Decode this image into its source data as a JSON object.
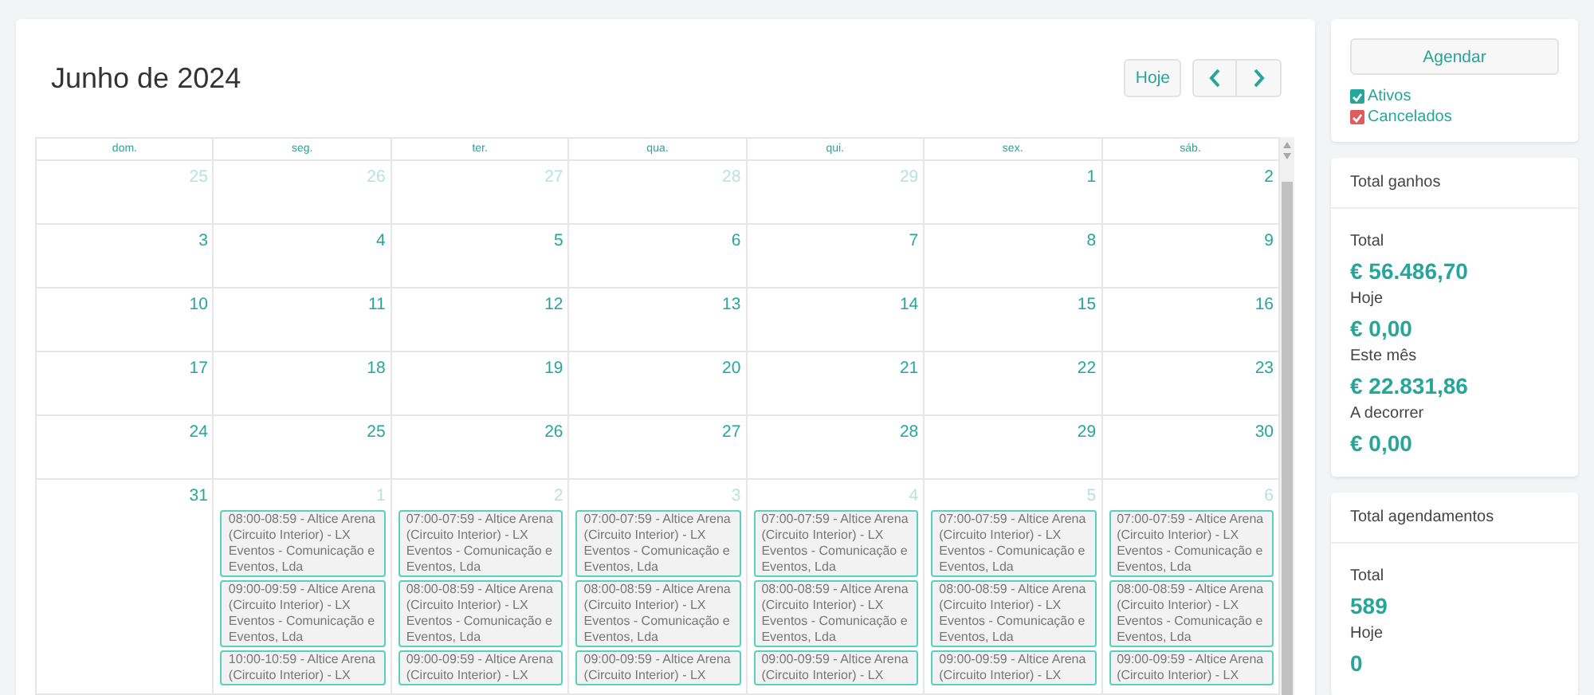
{
  "calendar": {
    "title": "Junho de 2024",
    "today_button": "Hoje",
    "weekdays": [
      "dom.",
      "seg.",
      "ter.",
      "qua.",
      "qui.",
      "sex.",
      "sáb."
    ],
    "weeks": [
      [
        {
          "day": "25",
          "other_month": true
        },
        {
          "day": "26",
          "other_month": true
        },
        {
          "day": "27",
          "other_month": true
        },
        {
          "day": "28",
          "other_month": true
        },
        {
          "day": "29",
          "other_month": true
        },
        {
          "day": "1",
          "other_month": false
        },
        {
          "day": "2",
          "other_month": false
        }
      ],
      [
        {
          "day": "3",
          "other_month": false
        },
        {
          "day": "4",
          "other_month": false
        },
        {
          "day": "5",
          "other_month": false
        },
        {
          "day": "6",
          "other_month": false
        },
        {
          "day": "7",
          "other_month": false
        },
        {
          "day": "8",
          "other_month": false
        },
        {
          "day": "9",
          "other_month": false
        }
      ],
      [
        {
          "day": "10",
          "other_month": false
        },
        {
          "day": "11",
          "other_month": false
        },
        {
          "day": "12",
          "other_month": false
        },
        {
          "day": "13",
          "other_month": false
        },
        {
          "day": "14",
          "other_month": false
        },
        {
          "day": "15",
          "other_month": false
        },
        {
          "day": "16",
          "other_month": false
        }
      ],
      [
        {
          "day": "17",
          "other_month": false
        },
        {
          "day": "18",
          "other_month": false
        },
        {
          "day": "19",
          "other_month": false
        },
        {
          "day": "20",
          "other_month": false
        },
        {
          "day": "21",
          "other_month": false
        },
        {
          "day": "22",
          "other_month": false
        },
        {
          "day": "23",
          "other_month": false
        }
      ],
      [
        {
          "day": "24",
          "other_month": false
        },
        {
          "day": "25",
          "other_month": false
        },
        {
          "day": "26",
          "other_month": false
        },
        {
          "day": "27",
          "other_month": false
        },
        {
          "day": "28",
          "other_month": false
        },
        {
          "day": "29",
          "other_month": false
        },
        {
          "day": "30",
          "other_month": false
        }
      ],
      [
        {
          "day": "31",
          "other_month": false
        },
        {
          "day": "1",
          "other_month": true,
          "events": [
            "08:00-08:59 - Altice Arena (Circuito Interior) - LX Eventos - Comunicação e Eventos, Lda",
            "09:00-09:59 - Altice Arena (Circuito Interior) - LX Eventos - Comunicação e Eventos, Lda",
            "10:00-10:59 - Altice Arena (Circuito Interior) - LX"
          ]
        },
        {
          "day": "2",
          "other_month": true,
          "events": [
            "07:00-07:59 - Altice Arena (Circuito Interior) - LX Eventos - Comunicação e Eventos, Lda",
            "08:00-08:59 - Altice Arena (Circuito Interior) - LX Eventos - Comunicação e Eventos, Lda",
            "09:00-09:59 - Altice Arena (Circuito Interior) - LX"
          ]
        },
        {
          "day": "3",
          "other_month": true,
          "events": [
            "07:00-07:59 - Altice Arena (Circuito Interior) - LX Eventos - Comunicação e Eventos, Lda",
            "08:00-08:59 - Altice Arena (Circuito Interior) - LX Eventos - Comunicação e Eventos, Lda",
            "09:00-09:59 - Altice Arena (Circuito Interior) - LX"
          ]
        },
        {
          "day": "4",
          "other_month": true,
          "events": [
            "07:00-07:59 - Altice Arena (Circuito Interior) - LX Eventos - Comunicação e Eventos, Lda",
            "08:00-08:59 - Altice Arena (Circuito Interior) - LX Eventos - Comunicação e Eventos, Lda",
            "09:00-09:59 - Altice Arena (Circuito Interior) - LX"
          ]
        },
        {
          "day": "5",
          "other_month": true,
          "events": [
            "07:00-07:59 - Altice Arena (Circuito Interior) - LX Eventos - Comunicação e Eventos, Lda",
            "08:00-08:59 - Altice Arena (Circuito Interior) - LX Eventos - Comunicação e Eventos, Lda",
            "09:00-09:59 - Altice Arena (Circuito Interior) - LX"
          ]
        },
        {
          "day": "6",
          "other_month": true,
          "events": [
            "07:00-07:59 - Altice Arena (Circuito Interior) - LX Eventos - Comunicação e Eventos, Lda",
            "08:00-08:59 - Altice Arena (Circuito Interior) - LX Eventos - Comunicação e Eventos, Lda",
            "09:00-09:59 - Altice Arena (Circuito Interior) - LX"
          ]
        }
      ]
    ]
  },
  "actions": {
    "button": "Agendar",
    "filters": [
      {
        "label": "Ativos",
        "checked": true,
        "color": "#26a69a"
      },
      {
        "label": "Cancelados",
        "checked": true,
        "color": "#e05c5c"
      }
    ]
  },
  "earnings": {
    "title": "Total ganhos",
    "stats": [
      {
        "label": "Total",
        "value": "€ 56.486,70"
      },
      {
        "label": "Hoje",
        "value": "€ 0,00"
      },
      {
        "label": "Este mês",
        "value": "€ 22.831,86"
      },
      {
        "label": "A decorrer",
        "value": "€ 0,00"
      }
    ]
  },
  "bookings": {
    "title": "Total agendamentos",
    "stats": [
      {
        "label": "Total",
        "value": "589"
      },
      {
        "label": "Hoje",
        "value": "0"
      }
    ]
  }
}
